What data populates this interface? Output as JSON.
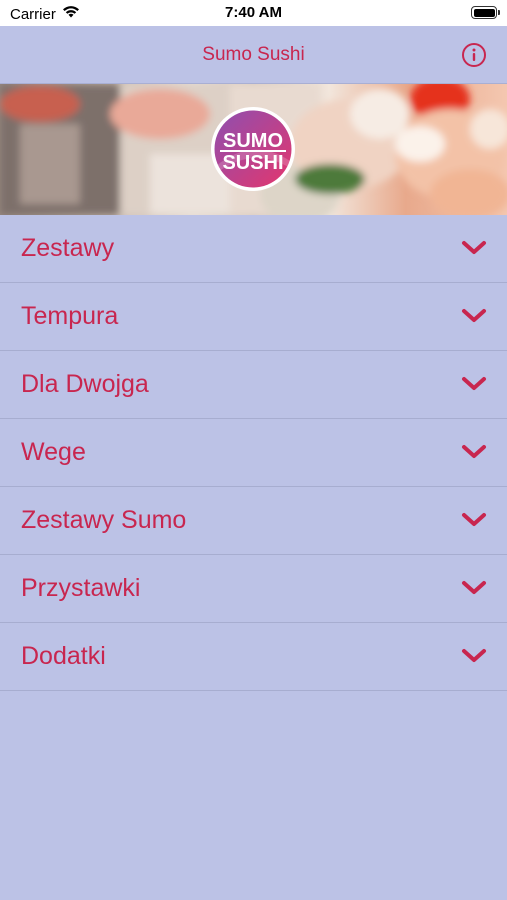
{
  "status_bar": {
    "carrier": "Carrier",
    "time": "7:40 AM",
    "wifi_icon": "wifi-icon",
    "battery_icon": "battery-icon"
  },
  "nav": {
    "title": "Sumo Sushi",
    "info_icon": "info-icon"
  },
  "banner": {
    "logo_line1": "SUMO",
    "logo_line2": "SUSHI"
  },
  "menu": {
    "items": [
      {
        "label": "Zestawy"
      },
      {
        "label": "Tempura"
      },
      {
        "label": "Dla Dwojga"
      },
      {
        "label": "Wege"
      },
      {
        "label": "Zestawy Sumo"
      },
      {
        "label": "Przystawki"
      },
      {
        "label": "Dodatki"
      }
    ],
    "chevron_icon": "chevron-down-icon"
  },
  "colors": {
    "accent": "#C8264F",
    "background": "#BCC2E6",
    "divider": "#A7ADD0"
  }
}
